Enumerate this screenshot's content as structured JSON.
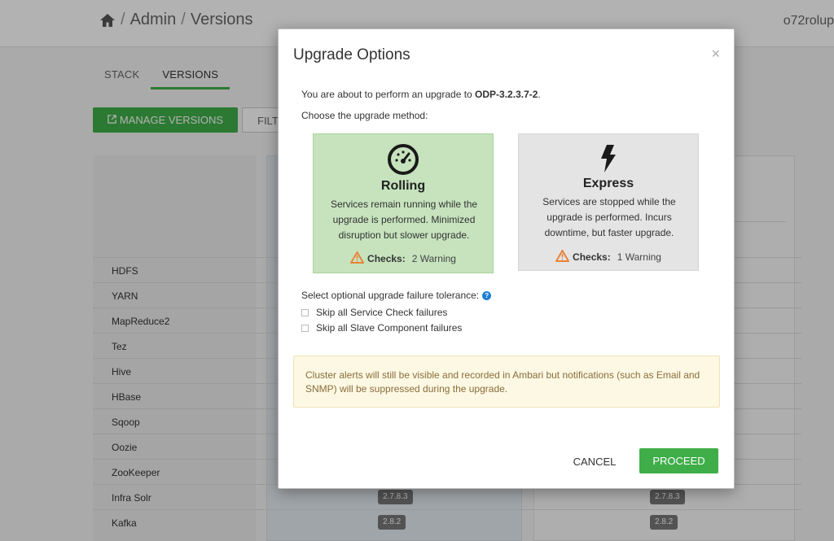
{
  "background": {
    "breadcrumb": {
      "admin": "Admin",
      "separator": "/",
      "page": "Versions"
    },
    "user_name": "o72rolup",
    "tabs": [
      {
        "label": "STACK"
      },
      {
        "label": "VERSIONS"
      }
    ],
    "manage_versions_label": "MANAGE VERSIONS",
    "filter_label": "FILT",
    "services": [
      {
        "name": "HDFS"
      },
      {
        "name": "YARN"
      },
      {
        "name": "MapReduce2"
      },
      {
        "name": "Tez"
      },
      {
        "name": "Hive"
      },
      {
        "name": "HBase"
      },
      {
        "name": "Sqoop"
      },
      {
        "name": "Oozie"
      },
      {
        "name": "ZooKeeper"
      },
      {
        "name": "Infra Solr",
        "version_a": "2.7.8.3",
        "version_b": "2.7.8.3"
      },
      {
        "name": "Kafka",
        "version_a": "2.8.2",
        "version_b": "2.8.2"
      }
    ]
  },
  "modal": {
    "title": "Upgrade Options",
    "close": "×",
    "intro_prefix": "You are about to perform an upgrade to ",
    "target_version": "ODP-3.2.3.7-2",
    "intro_suffix": ".",
    "choose_method": "Choose the upgrade method:",
    "options": {
      "rolling": {
        "title": "Rolling",
        "icon": "speedometer-icon",
        "description": "Services remain running while the upgrade is performed. Minimized disruption but slower upgrade.",
        "checks_label": "Checks:",
        "checks_value": "2 Warning",
        "selected": true
      },
      "express": {
        "title": "Express",
        "icon": "lightning-icon",
        "description": "Services are stopped while the upgrade is performed. Incurs downtime, but faster upgrade.",
        "checks_label": "Checks:",
        "checks_value": "1 Warning",
        "selected": false
      }
    },
    "tolerance_label": "Select optional upgrade failure tolerance:",
    "skip_service_check": "Skip all Service Check failures",
    "skip_slave_component": "Skip all Slave Component failures",
    "alert_text": "Cluster alerts will still be visible and recorded in Ambari but notifications (such as Email and SNMP) will be suppressed during the upgrade.",
    "cancel_label": "CANCEL",
    "proceed_label": "PROCEED"
  },
  "colors": {
    "accent_green": "#3fae49",
    "rolling_selected_bg": "#c6e3bd",
    "express_bg": "#e4e4e4",
    "warning_orange": "#e8833a",
    "alert_bg": "#fcf8e3",
    "alert_text": "#8a6d3b",
    "help_blue": "#1e7ed4"
  }
}
